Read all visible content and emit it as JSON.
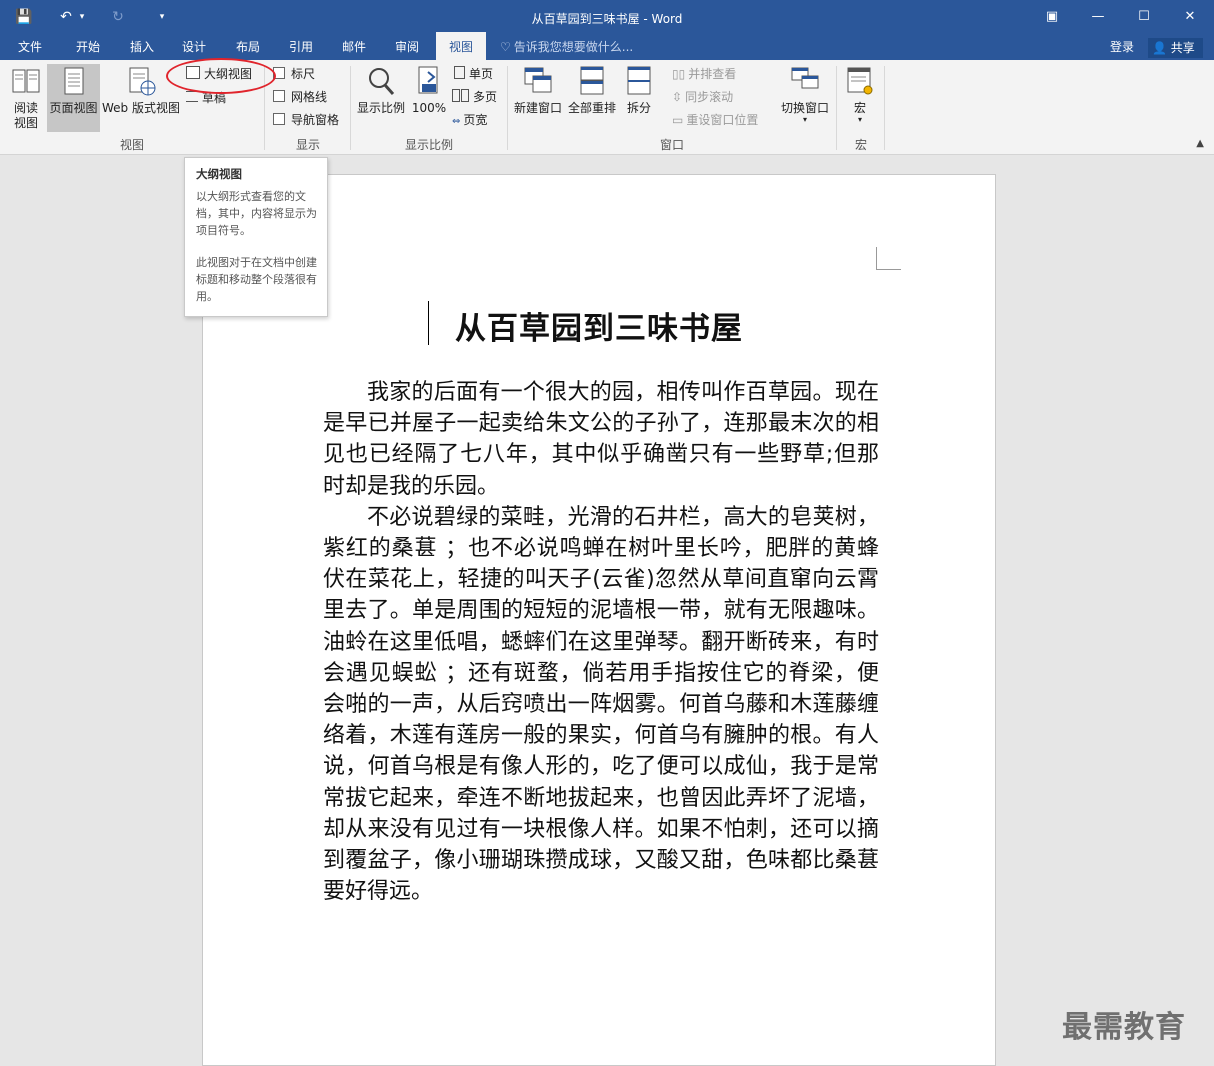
{
  "window": {
    "title": "从百草园到三味书屋 - Word",
    "qat": {
      "save": "💾",
      "undo": "↶",
      "undo_arrow": "▾",
      "redo": "↻",
      "customize": "▾"
    },
    "controls": {
      "ribbon_opts": "▣",
      "minimize": "—",
      "maximize": "☐",
      "close": "✕"
    }
  },
  "tabs": {
    "items": [
      "文件",
      "开始",
      "插入",
      "设计",
      "布局",
      "引用",
      "邮件",
      "审阅",
      "视图"
    ],
    "active": "视图",
    "tell_me": "告诉我您想要做什么...",
    "sign_in": "登录",
    "share": "共享"
  },
  "ribbon": {
    "view_group": {
      "label": "视图",
      "read_mode": "阅读视图",
      "print_layout": "页面视图",
      "web_layout": "Web 版式视图",
      "outline": "大纲视图",
      "draft": "草稿"
    },
    "show_group": {
      "label": "显示",
      "ruler": "标尺",
      "gridlines": "网格线",
      "nav_pane": "导航窗格"
    },
    "zoom_group": {
      "label": "显示比例",
      "zoom": "显示比例",
      "zoom100": "100%",
      "one_page": "单页",
      "multi_page": "多页",
      "page_width": "页宽"
    },
    "window_group": {
      "label": "窗口",
      "new_window": "新建窗口",
      "arrange_all": "全部重排",
      "split": "拆分",
      "side_by_side": "并排查看",
      "sync_scroll": "同步滚动",
      "reset_pos": "重设窗口位置",
      "switch_windows": "切换窗口"
    },
    "macro_group": {
      "label": "宏",
      "macros": "宏"
    }
  },
  "tooltip": {
    "title": "大纲视图",
    "p1": "以大纲形式查看您的文档，其中，内容将显示为项目符号。",
    "p2": "此视图对于在文档中创建标题和移动整个段落很有用。"
  },
  "document": {
    "title": "从百草园到三味书屋",
    "paragraphs": [
      "我家的后面有一个很大的园，相传叫作百草园。现在是早已并屋子一起卖给朱文公的子孙了，连那最末次的相见也已经隔了七八年，其中似乎确凿只有一些野草;但那时却是我的乐园。",
      "不必说碧绿的菜畦，光滑的石井栏，高大的皂荚树，紫红的桑葚 ；也不必说鸣蝉在树叶里长吟，肥胖的黄蜂伏在菜花上，轻捷的叫天子(云雀)忽然从草间直窜向云霄里去了。单是周围的短短的泥墙根一带，就有无限趣味。油蛉在这里低唱，蟋蟀们在这里弹琴。翻开断砖来，有时会遇见蜈蚣 ；还有斑蝥，倘若用手指按住它的脊梁，便会啪的一声，从后窍喷出一阵烟雾。何首乌藤和木莲藤缠络着，木莲有莲房一般的果实，何首乌有臃肿的根。有人说，何首乌根是有像人形的，吃了便可以成仙，我于是常常拔它起来，牵连不断地拔起来，也曾因此弄坏了泥墙，却从来没有见过有一块根像人样。如果不怕刺，还可以摘到覆盆子，像小珊瑚珠攒成球，又酸又甜，色味都比桑葚要好得远。"
    ]
  },
  "watermark": "最需教育",
  "colors": {
    "brand": "#2b579a",
    "highlight": "#e0242c"
  }
}
